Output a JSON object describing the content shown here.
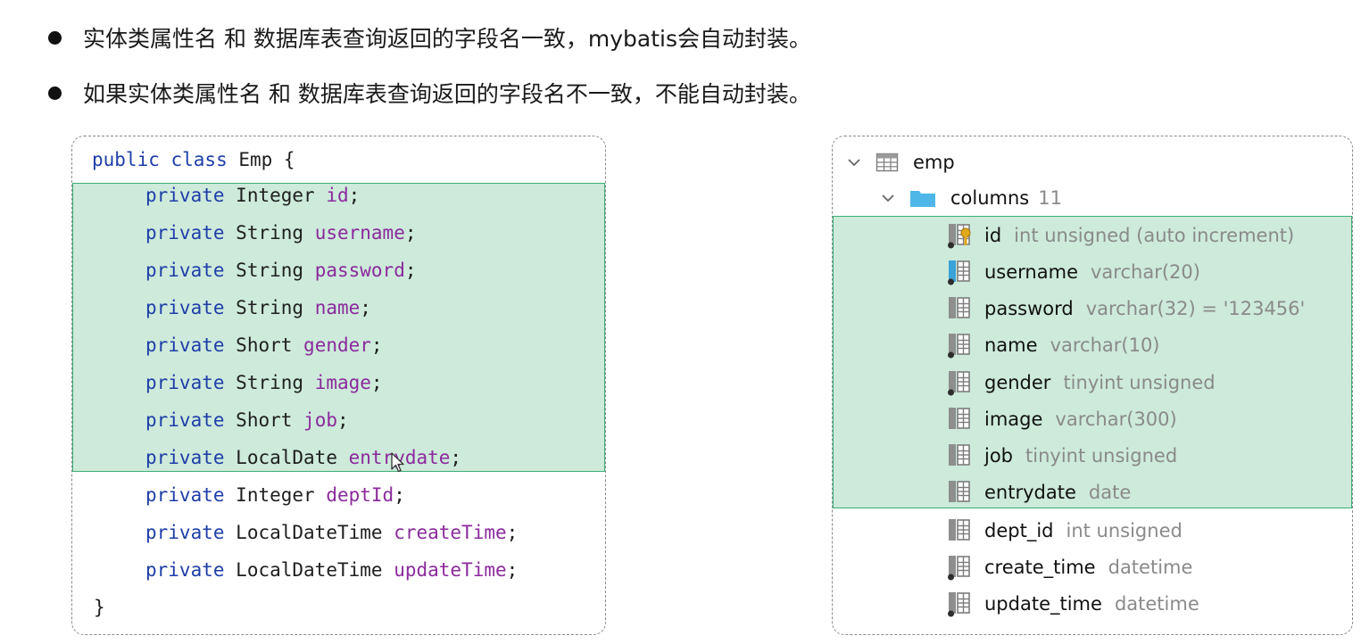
{
  "bullets": [
    "实体类属性名 和 数据库表查询返回的字段名一致，mybatis会自动封装。",
    "如果实体类属性名 和 数据库表查询返回的字段名不一致，不能自动封装。"
  ],
  "code": {
    "class_open": {
      "kw": "public class",
      "rest": " Emp {"
    },
    "fields": [
      {
        "kw": "private",
        "type": "Integer",
        "name": "id",
        "end": ";"
      },
      {
        "kw": "private",
        "type": "String",
        "name": "username",
        "end": ";"
      },
      {
        "kw": "private",
        "type": "String",
        "name": "password",
        "end": ";"
      },
      {
        "kw": "private",
        "type": "String",
        "name": "name",
        "end": ";"
      },
      {
        "kw": "private",
        "type": "Short",
        "name": "gender",
        "end": ";"
      },
      {
        "kw": "private",
        "type": "String",
        "name": "image",
        "end": ";"
      },
      {
        "kw": "private",
        "type": "Short",
        "name": "job",
        "end": ";"
      },
      {
        "kw": "private",
        "type": "LocalDate",
        "name": "entrydate",
        "end": ";"
      },
      {
        "kw": "private",
        "type": "Integer",
        "name": "deptId",
        "end": ";"
      },
      {
        "kw": "private",
        "type": "LocalDateTime",
        "name": "createTime",
        "end": ";"
      },
      {
        "kw": "private",
        "type": "LocalDateTime",
        "name": "updateTime",
        "end": ";"
      }
    ],
    "class_close": "}"
  },
  "db": {
    "table": {
      "name": "emp",
      "icon": "table-icon"
    },
    "columns_folder": {
      "label": "columns",
      "count": "11",
      "icon": "folder-icon"
    },
    "columns": [
      {
        "name": "id",
        "type": "int unsigned (auto increment)",
        "icon": "primary-key-column-icon"
      },
      {
        "name": "username",
        "type": "varchar(20)",
        "icon": "indexed-column-icon"
      },
      {
        "name": "password",
        "type": "varchar(32) = '123456'",
        "icon": "column-icon"
      },
      {
        "name": "name",
        "type": "varchar(10)",
        "icon": "indexed-column-icon"
      },
      {
        "name": "gender",
        "type": "tinyint unsigned",
        "icon": "indexed-column-icon"
      },
      {
        "name": "image",
        "type": "varchar(300)",
        "icon": "column-icon"
      },
      {
        "name": "job",
        "type": "tinyint unsigned",
        "icon": "column-icon"
      },
      {
        "name": "entrydate",
        "type": "date",
        "icon": "column-icon"
      },
      {
        "name": "dept_id",
        "type": "int unsigned",
        "icon": "column-icon"
      },
      {
        "name": "create_time",
        "type": "datetime",
        "icon": "indexed-column-icon"
      },
      {
        "name": "update_time",
        "type": "datetime",
        "icon": "indexed-column-icon"
      }
    ]
  },
  "colors": {
    "highlight_fill": "#cdeadb",
    "highlight_border": "#3fae78",
    "keyword": "#1e3ea8",
    "field_name": "#8b2a9c",
    "column_type": "#8a8a8a",
    "folder": "#4fb6e8"
  }
}
